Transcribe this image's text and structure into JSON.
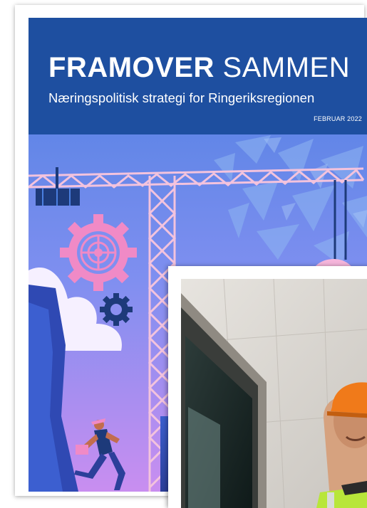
{
  "cover": {
    "title_bold": "FRAMOVER",
    "title_light": "SAMMEN",
    "subtitle": "Næringspolitisk strategi for Ringeriksregionen",
    "date": "FEBRUAR 2022"
  },
  "colors": {
    "header_blue": "#1e4fa0",
    "art_top": "#4a7fe0",
    "art_bottom": "#c98ef0",
    "crane": "#f3c3dd",
    "gear_pink": "#f08ac6",
    "gear_navy": "#1d3a7a",
    "hardhat": "#f07a1a",
    "vest": "#b8e63a"
  },
  "icons": {
    "crane": "crane-illustration",
    "gear_large": "gear-icon",
    "gear_small": "gear-icon",
    "worker": "running-worker-illustration",
    "coat_of_arms": "coat-of-arms-icon",
    "photo": "construction-worker-photo"
  }
}
